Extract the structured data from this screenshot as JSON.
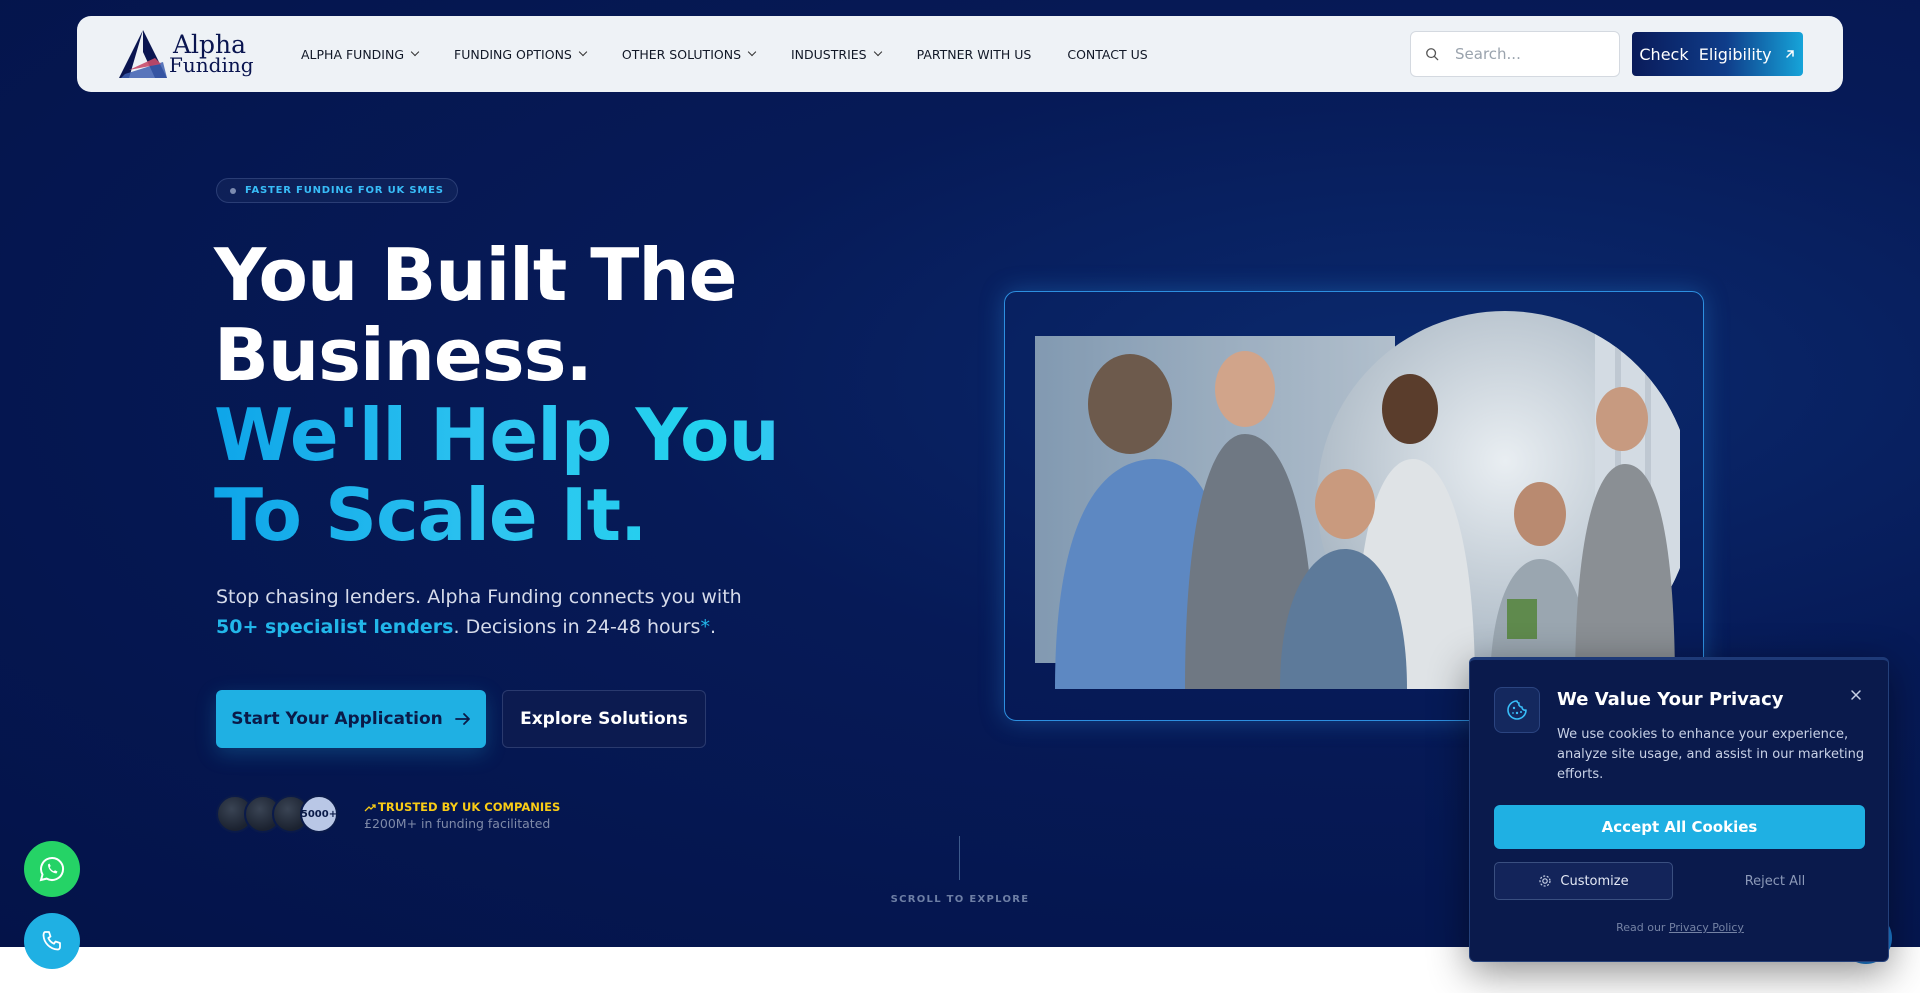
{
  "nav": {
    "logo_line1": "Alpha",
    "logo_line2": "Funding",
    "menu": [
      {
        "label": "ALPHA FUNDING",
        "has_dropdown": true
      },
      {
        "label": "FUNDING OPTIONS",
        "has_dropdown": true
      },
      {
        "label": "OTHER SOLUTIONS",
        "has_dropdown": true
      },
      {
        "label": "INDUSTRIES",
        "has_dropdown": true
      },
      {
        "label": "PARTNER WITH US",
        "has_dropdown": false
      },
      {
        "label": "CONTACT US",
        "has_dropdown": false
      }
    ],
    "search_placeholder": "Search...",
    "cta": "Check  Eligibility"
  },
  "hero": {
    "badge": "FASTER FUNDING FOR UK SMES",
    "headline_line1": "You Built The",
    "headline_line2": "Business.",
    "headline_line3": "We'll Help You",
    "headline_line4": "To Scale It.",
    "sub_part1": "Stop chasing lenders. Alpha Funding connects you with ",
    "sub_highlight": "50+ specialist lenders",
    "sub_part2": ". Decisions in 24-48 hours",
    "sub_asterisk": "*",
    "sub_end": ".",
    "primary_button": "Start Your Application",
    "secondary_button": "Explore Solutions",
    "avatar_count": "5000+",
    "trusted_title": "TRUSTED BY UK COMPANIES",
    "trusted_sub": "£200M+ in funding facilitated",
    "scroll_text": "SCROLL TO EXPLORE"
  },
  "cookie": {
    "title": "We Value Your Privacy",
    "body": "We use cookies to enhance your experience, analyze site usage, and assist in our marketing efforts.",
    "accept": "Accept All Cookies",
    "customize": "Customize",
    "reject": "Reject All",
    "footer_prefix": "Read our ",
    "footer_link": "Privacy Policy"
  },
  "colors": {
    "accent": "#1fb0e3",
    "navy": "#061a57",
    "whatsapp": "#25d366",
    "trusted": "#facc15"
  },
  "icons": [
    "search-icon",
    "arrow-up-right-icon",
    "arrow-right-icon",
    "trending-up-icon",
    "whatsapp-icon",
    "phone-icon",
    "chat-icon",
    "cookie-icon",
    "close-icon",
    "gear-icon"
  ]
}
